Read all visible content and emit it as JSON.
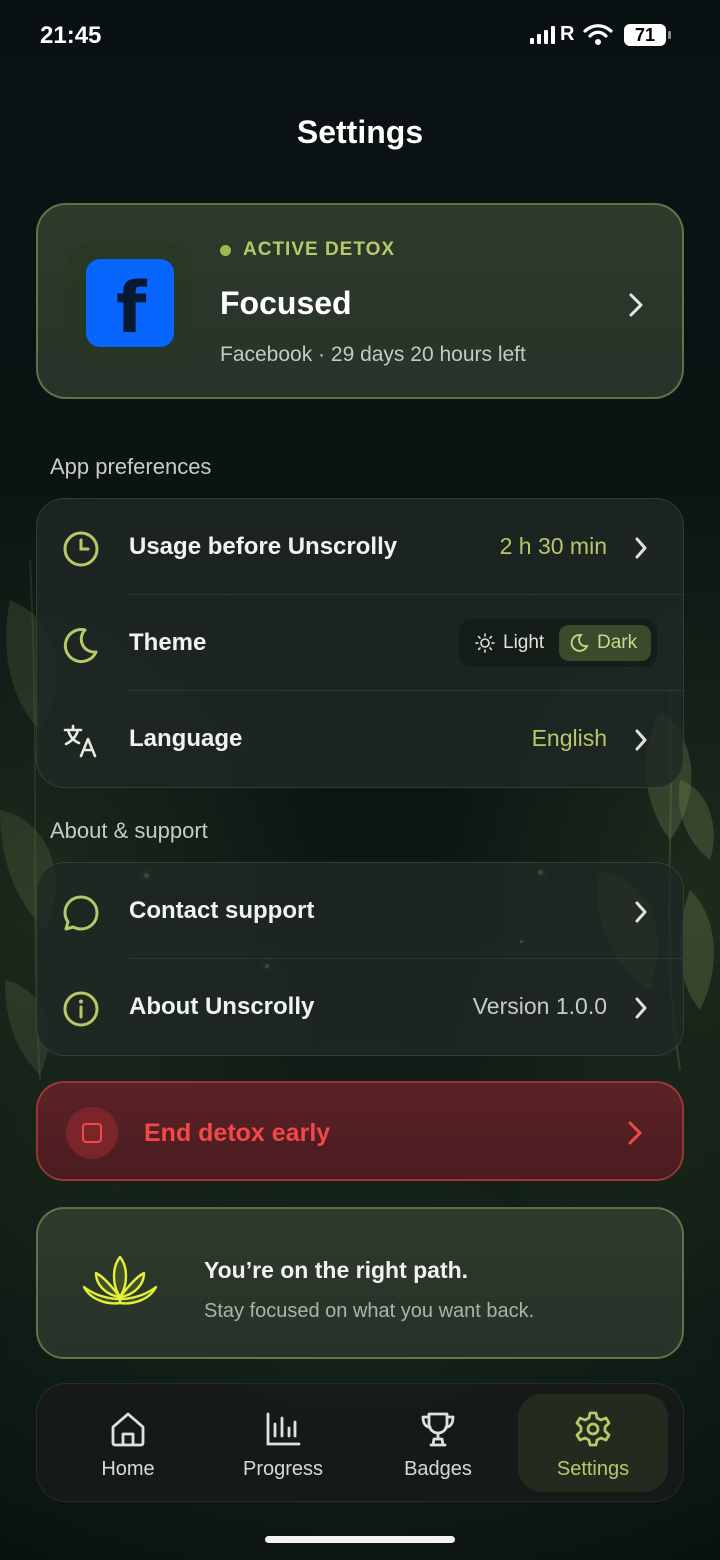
{
  "status_bar": {
    "time": "21:45",
    "signal_label": "R",
    "battery": "71"
  },
  "page_title": "Settings",
  "detox": {
    "status": "ACTIVE DETOX",
    "title": "Focused",
    "subtitle": "Facebook · 29 days 20 hours left",
    "app_icon": "facebook-icon"
  },
  "sections": {
    "preferences_title": "App preferences",
    "support_title": "About & support"
  },
  "preferences": {
    "usage": {
      "label": "Usage before Unscrolly",
      "value": "2 h 30 min",
      "icon": "clock-icon"
    },
    "theme": {
      "label": "Theme",
      "light": "Light",
      "dark": "Dark",
      "selected": "Dark",
      "icon": "moon-icon"
    },
    "language": {
      "label": "Language",
      "value": "English",
      "icon": "translate-icon"
    }
  },
  "support": {
    "contact": {
      "label": "Contact support",
      "icon": "chat-bubble-icon"
    },
    "about": {
      "label": "About Unscrolly",
      "value": "Version 1.0.0",
      "icon": "info-icon"
    }
  },
  "end_detox": {
    "label": "End detox early",
    "icon": "stop-icon"
  },
  "motto": {
    "title": "You’re on the right path.",
    "subtitle": "Stay focused on what you want back.",
    "icon": "lotus-icon"
  },
  "nav": {
    "home": "Home",
    "progress": "Progress",
    "badges": "Badges",
    "settings": "Settings",
    "active": "settings"
  },
  "colors": {
    "accent": "#b5c96a",
    "danger": "#f24848",
    "background": "#081012",
    "facebook": "#0866ff"
  }
}
